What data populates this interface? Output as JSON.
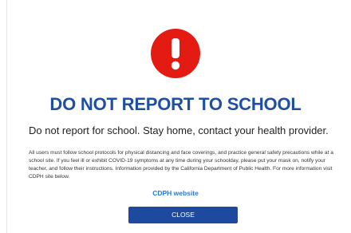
{
  "alert": {
    "icon": "exclamation-circle-icon",
    "icon_color": "#e41b13",
    "title": "DO NOT REPORT TO SCHOOL",
    "title_color": "#1f4fa3",
    "subtitle": "Do not report for school. Stay home, contact your health provider.",
    "body": "All users must follow school protocols for physical distancing and face coverings, and practice general safety precautions while at a school site. If you feel ill or exhibit COVID-19 symptoms at any time during your schoolday, please put your mask on, notify your teacher, and follow their instructions. Information provided by the California Department of Public Health. For more information visit CDPH site below.",
    "link_label": "CDPH website",
    "link_color": "#2a7ad4",
    "close_label": "CLOSE",
    "close_color": "#1d4a9e"
  }
}
